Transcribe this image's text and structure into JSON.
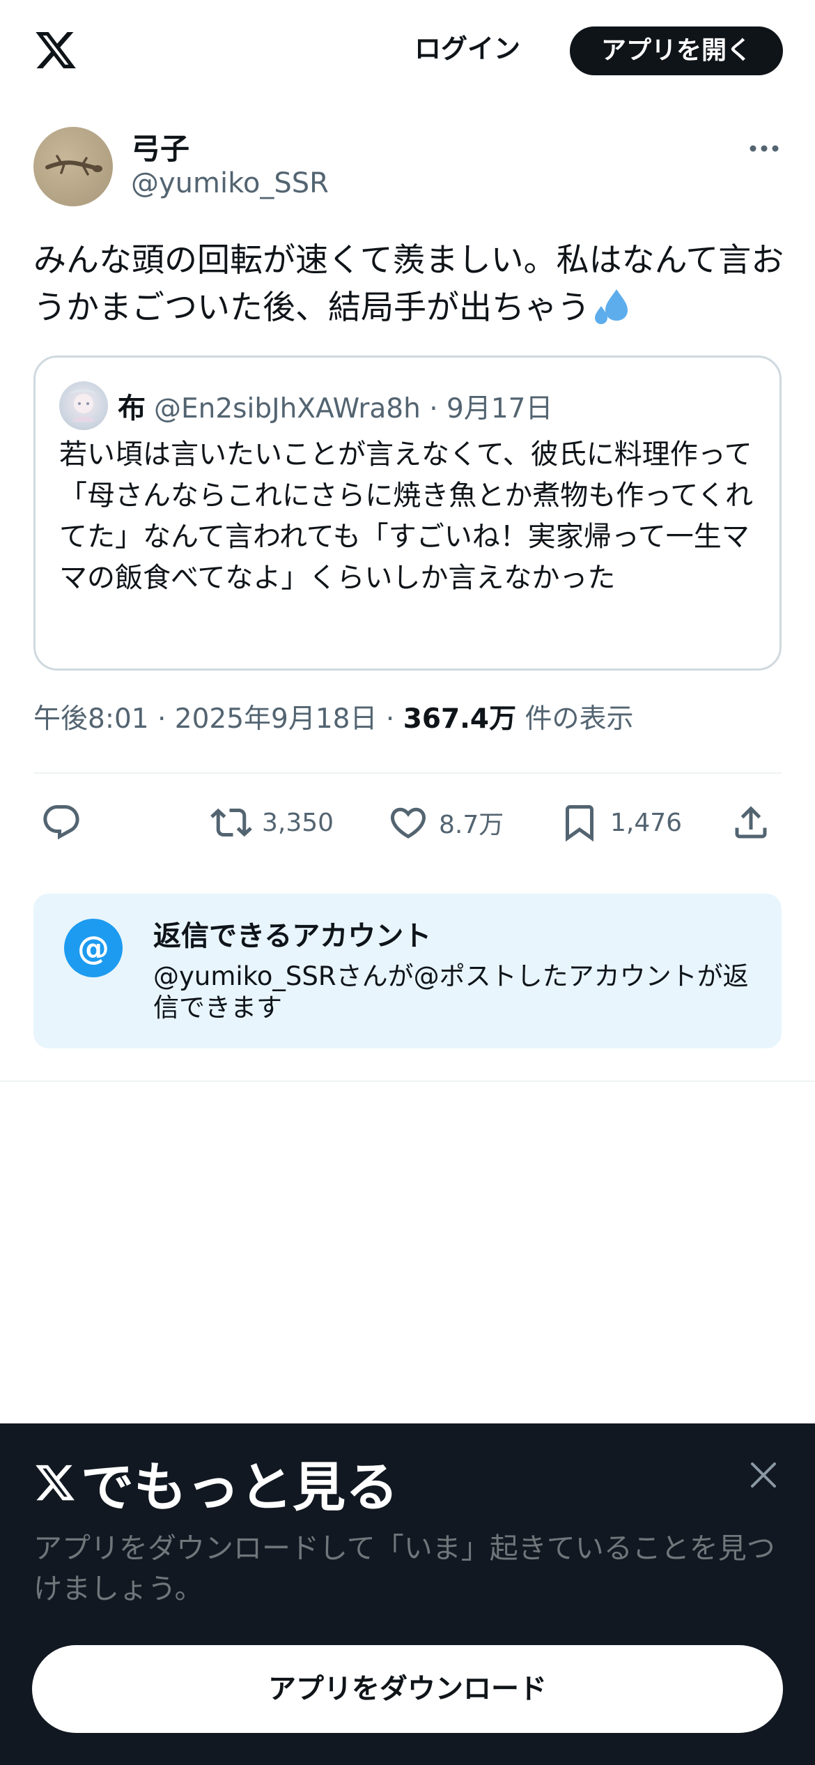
{
  "header": {
    "login_label": "ログイン",
    "open_app_label": "アプリを開く"
  },
  "post": {
    "display_name": "弓子",
    "handle": "@yumiko_SSR",
    "text": "みんな頭の回転が速くて羨ましい。私はなんて言おうかまごついた後、結局手が出ちゃう",
    "emoji": "sweat-droplets",
    "time": "午後8:01",
    "date": "2025年9月18日",
    "views_count": "367.4万",
    "views_label": "件の表示",
    "separator": " · "
  },
  "quote": {
    "name": "布",
    "handle": "@En2sibJhXAWra8h · 9月17日",
    "text": "若い頃は言いたいことが言えなくて、彼氏に料理作って「母さんならこれにさらに焼き魚とか煮物も作ってくれてた」なんて言われても「すごいね！実家帰って一生ママの飯食べてなよ」くらいしか言えなかった"
  },
  "actions": {
    "retweets": "3,350",
    "likes": "8.7万",
    "bookmarks": "1,476"
  },
  "reply_info": {
    "icon_label": "@",
    "title": "返信できるアカウント",
    "description": "@yumiko_SSRさんが@ポストしたアカウントが返信できます"
  },
  "promo": {
    "title": "でもっと見る",
    "text": "アプリをダウンロードして「いま」起きていることを見つけましょう。",
    "download_label": "アプリをダウンロード"
  },
  "colors": {
    "accent": "#1d9bf0",
    "text": "#0f1419",
    "muted": "#536471",
    "promo_bg": "#111821"
  }
}
